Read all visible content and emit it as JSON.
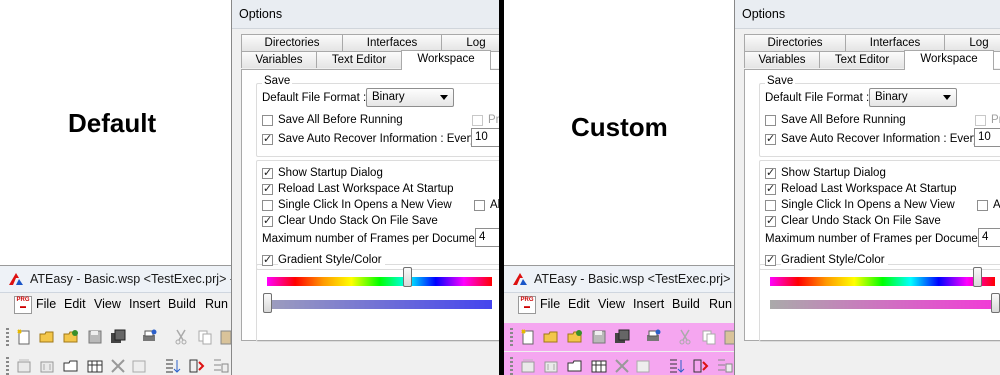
{
  "panels": [
    {
      "label": "Default",
      "app": {
        "title": "ATEasy - Basic.wsp <TestExec.prj> - [T",
        "menu": [
          "File",
          "Edit",
          "View",
          "Insert",
          "Build",
          "Run"
        ],
        "toolbar_color": "#f0f0f0"
      },
      "dialog": {
        "title": "Options",
        "tabs_back": [
          "Directories",
          "Interfaces",
          "Log"
        ],
        "tabs_front": [
          "Variables",
          "Text Editor",
          "Workspace"
        ],
        "active_tab": "Workspace",
        "save_group": "Save",
        "default_file_format_label": "Default File Format :",
        "default_file_format_value": "Binary",
        "save_all": {
          "label": "Save All Before Running",
          "checked": false
        },
        "truncated_right_1": "Pro",
        "save_auto": {
          "label": "Save Auto Recover Information : Every",
          "checked": true
        },
        "auto_minutes": "10",
        "show_startup": {
          "label": "Show Startup Dialog",
          "checked": true
        },
        "reload_last": {
          "label": "Reload Last Workspace At Startup",
          "checked": true
        },
        "single_click": {
          "label": "Single Click In Opens a New View",
          "checked": false
        },
        "truncated_right_2": "Al",
        "clear_undo": {
          "label": "Clear Undo Stack On File Save",
          "checked": true
        },
        "max_frames_label": "Maximum number of Frames per Document :",
        "max_frames": "4",
        "gradient": {
          "label": "Gradient Style/Color",
          "checked": true
        },
        "gradient_top_level": 0.62,
        "gradient_bottom_level": 0.0,
        "gradient_bottom_colors": [
          "#9e9ebd",
          "#4444ee"
        ]
      }
    },
    {
      "label": "Custom",
      "app": {
        "title": "ATEasy - Basic.wsp <TestExec.prj> - [T",
        "menu": [
          "File",
          "Edit",
          "View",
          "Insert",
          "Build",
          "Run"
        ],
        "toolbar_color": "#f5a6f0"
      },
      "dialog": {
        "title": "Options",
        "tabs_back": [
          "Directories",
          "Interfaces",
          "Log"
        ],
        "tabs_front": [
          "Variables",
          "Text Editor",
          "Workspace"
        ],
        "active_tab": "Workspace",
        "save_group": "Save",
        "default_file_format_label": "Default File Format :",
        "default_file_format_value": "Binary",
        "save_all": {
          "label": "Save All Before Running",
          "checked": false
        },
        "truncated_right_1": "Pr",
        "save_auto": {
          "label": "Save Auto Recover Information : Every",
          "checked": true
        },
        "auto_minutes": "10",
        "show_startup": {
          "label": "Show Startup Dialog",
          "checked": true
        },
        "reload_last": {
          "label": "Reload Last Workspace At Startup",
          "checked": true
        },
        "single_click": {
          "label": "Single Click In Opens a New View",
          "checked": false
        },
        "truncated_right_2": "A",
        "clear_undo": {
          "label": "Clear Undo Stack On File Save",
          "checked": true
        },
        "max_frames_label": "Maximum number of Frames per Document :",
        "max_frames": "4",
        "gradient": {
          "label": "Gradient Style/Color",
          "checked": true
        },
        "gradient_top_level": 0.92,
        "gradient_bottom_level": 1.0,
        "gradient_bottom_colors": [
          "#aaaaaa",
          "#f23ad7"
        ]
      }
    }
  ]
}
